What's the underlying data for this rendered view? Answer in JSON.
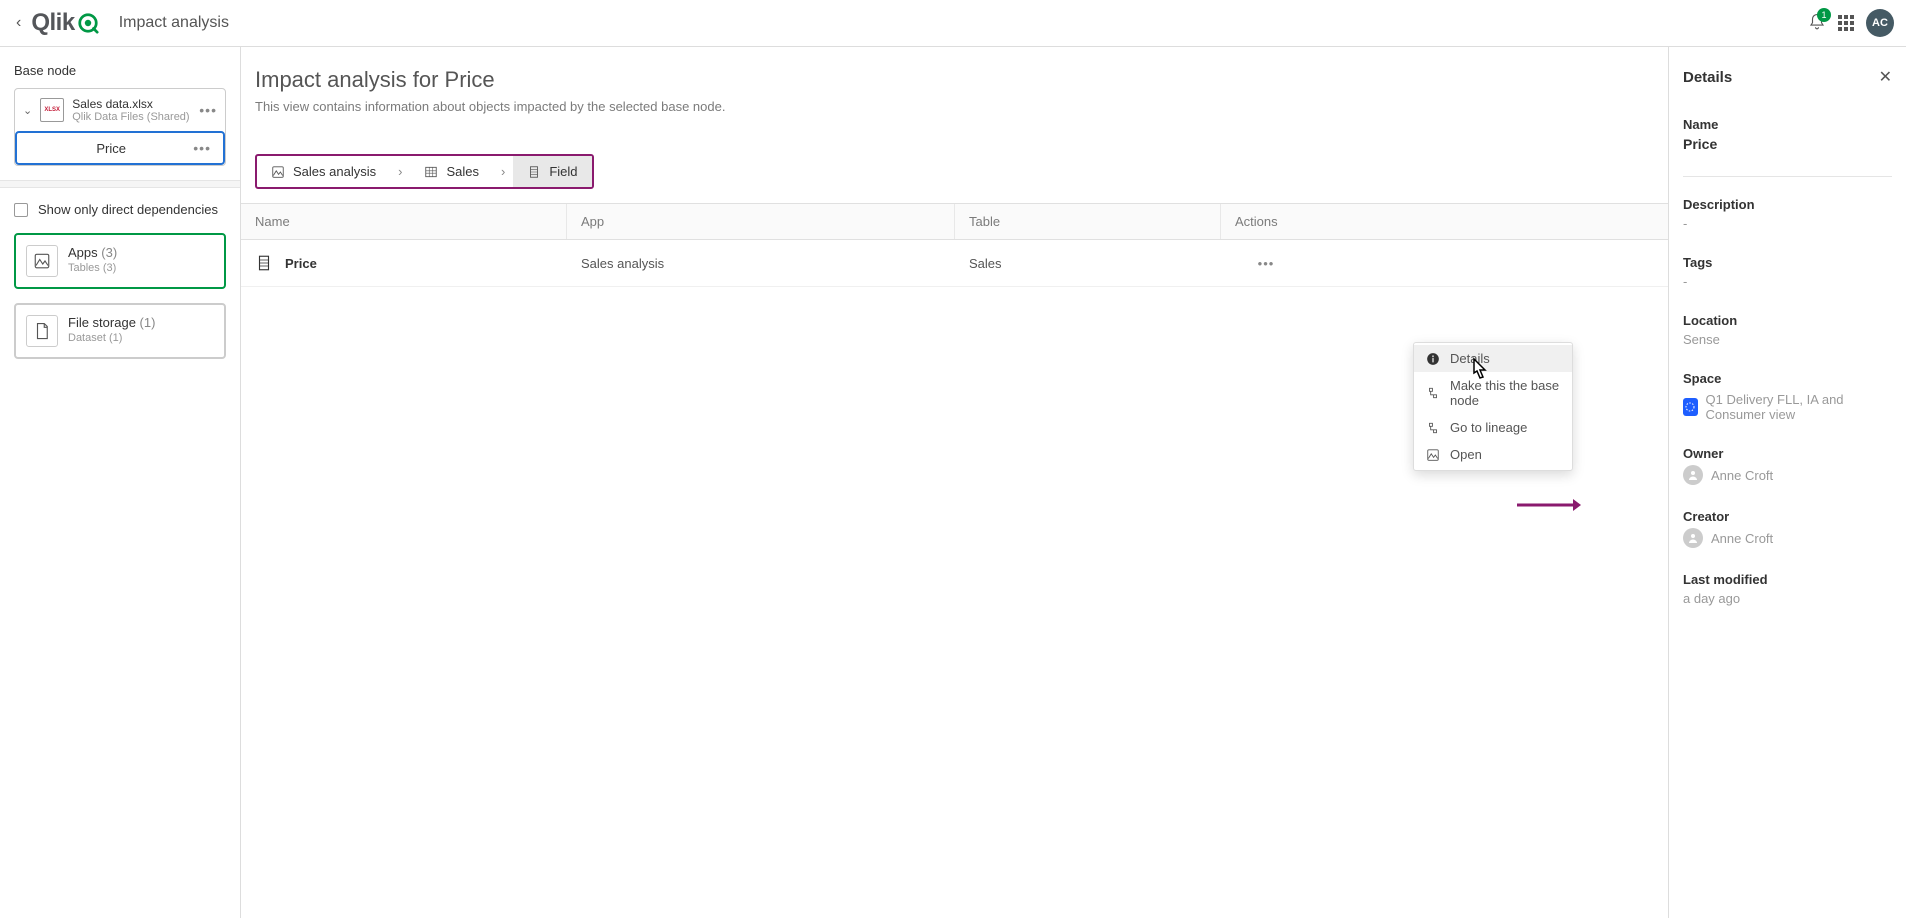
{
  "header": {
    "title": "Impact analysis",
    "notif_count": "1",
    "avatar": "AC"
  },
  "sidebar": {
    "base_label": "Base node",
    "file_name": "Sales data.xlsx",
    "file_sub": "Qlik Data Files (Shared)",
    "field_name": "Price",
    "direct_deps": "Show only direct dependencies",
    "apps_card": {
      "title": "Apps",
      "count": "(3)",
      "sub": "Tables (3)"
    },
    "storage_card": {
      "title": "File storage",
      "count": "(1)",
      "sub": "Dataset (1)"
    }
  },
  "main": {
    "title": "Impact analysis for Price",
    "subtitle": "This view contains information about objects impacted by the selected base node.",
    "breadcrumb": {
      "app": "Sales analysis",
      "table": "Sales",
      "field": "Field"
    },
    "columns": {
      "name": "Name",
      "app": "App",
      "table": "Table",
      "actions": "Actions"
    },
    "row": {
      "name": "Price",
      "app": "Sales analysis",
      "table": "Sales"
    },
    "ctx": {
      "details": "Details",
      "make_base": "Make this the base node",
      "lineage": "Go to lineage",
      "open": "Open"
    }
  },
  "details": {
    "title": "Details",
    "name_label": "Name",
    "name_value": "Price",
    "description_label": "Description",
    "description_value": "-",
    "tags_label": "Tags",
    "tags_value": "-",
    "location_label": "Location",
    "location_value": "Sense",
    "space_label": "Space",
    "space_value": "Q1 Delivery FLL, IA and Consumer view",
    "owner_label": "Owner",
    "owner_value": "Anne Croft",
    "creator_label": "Creator",
    "creator_value": "Anne Croft",
    "modified_label": "Last modified",
    "modified_value": "a day ago"
  }
}
